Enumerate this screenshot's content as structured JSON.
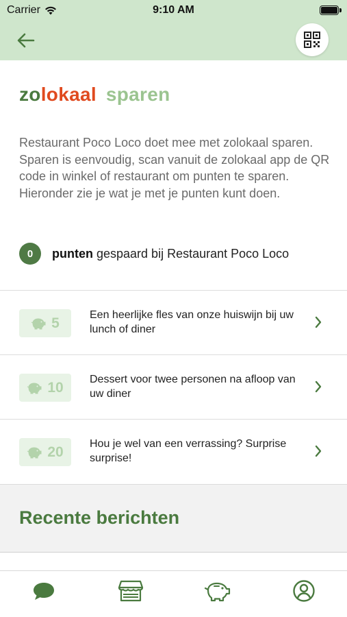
{
  "status_bar": {
    "carrier": "Carrier",
    "time": "9:10 AM"
  },
  "nav": {
    "back_icon": "arrow-left-icon",
    "qr_icon": "qr-code-icon"
  },
  "brand": {
    "zo": "zo",
    "lokaal": "lokaal",
    "sparen": "sparen"
  },
  "intro": "Restaurant Poco Loco doet mee met zolokaal sparen. Sparen is eenvoudig, scan vanuit de zolokaal app de QR code in winkel of restaurant om punten te sparen. Hieronder zie je wat je met je punten kunt doen.",
  "points": {
    "value": "0",
    "label_bold": "punten",
    "label_rest": " gespaard bij Restaurant Poco Loco"
  },
  "rewards": [
    {
      "points": "5",
      "text": "Een heerlijke fles van onze huiswijn bij uw lunch of diner",
      "icon": "piggy-bank-icon"
    },
    {
      "points": "10",
      "text": "Dessert voor twee personen na afloop van uw diner",
      "icon": "piggy-bank-icon"
    },
    {
      "points": "20",
      "text": "Hou je wel van een verrassing? Surprise surprise!",
      "icon": "piggy-bank-icon"
    }
  ],
  "recent": {
    "title": "Recente berichten"
  },
  "tabs": [
    {
      "name": "messages",
      "icon": "chat-bubble-icon",
      "active": true
    },
    {
      "name": "store",
      "icon": "store-icon",
      "active": false
    },
    {
      "name": "savings",
      "icon": "piggy-bank-icon",
      "active": false
    },
    {
      "name": "profile",
      "icon": "user-circle-icon",
      "active": false
    }
  ],
  "colors": {
    "header_bg": "#cfe6cc",
    "accent_green": "#4a7a3f",
    "brand_orange": "#e04a1f",
    "light_green": "#9bc490",
    "badge_bg": "#e8f3e6"
  }
}
